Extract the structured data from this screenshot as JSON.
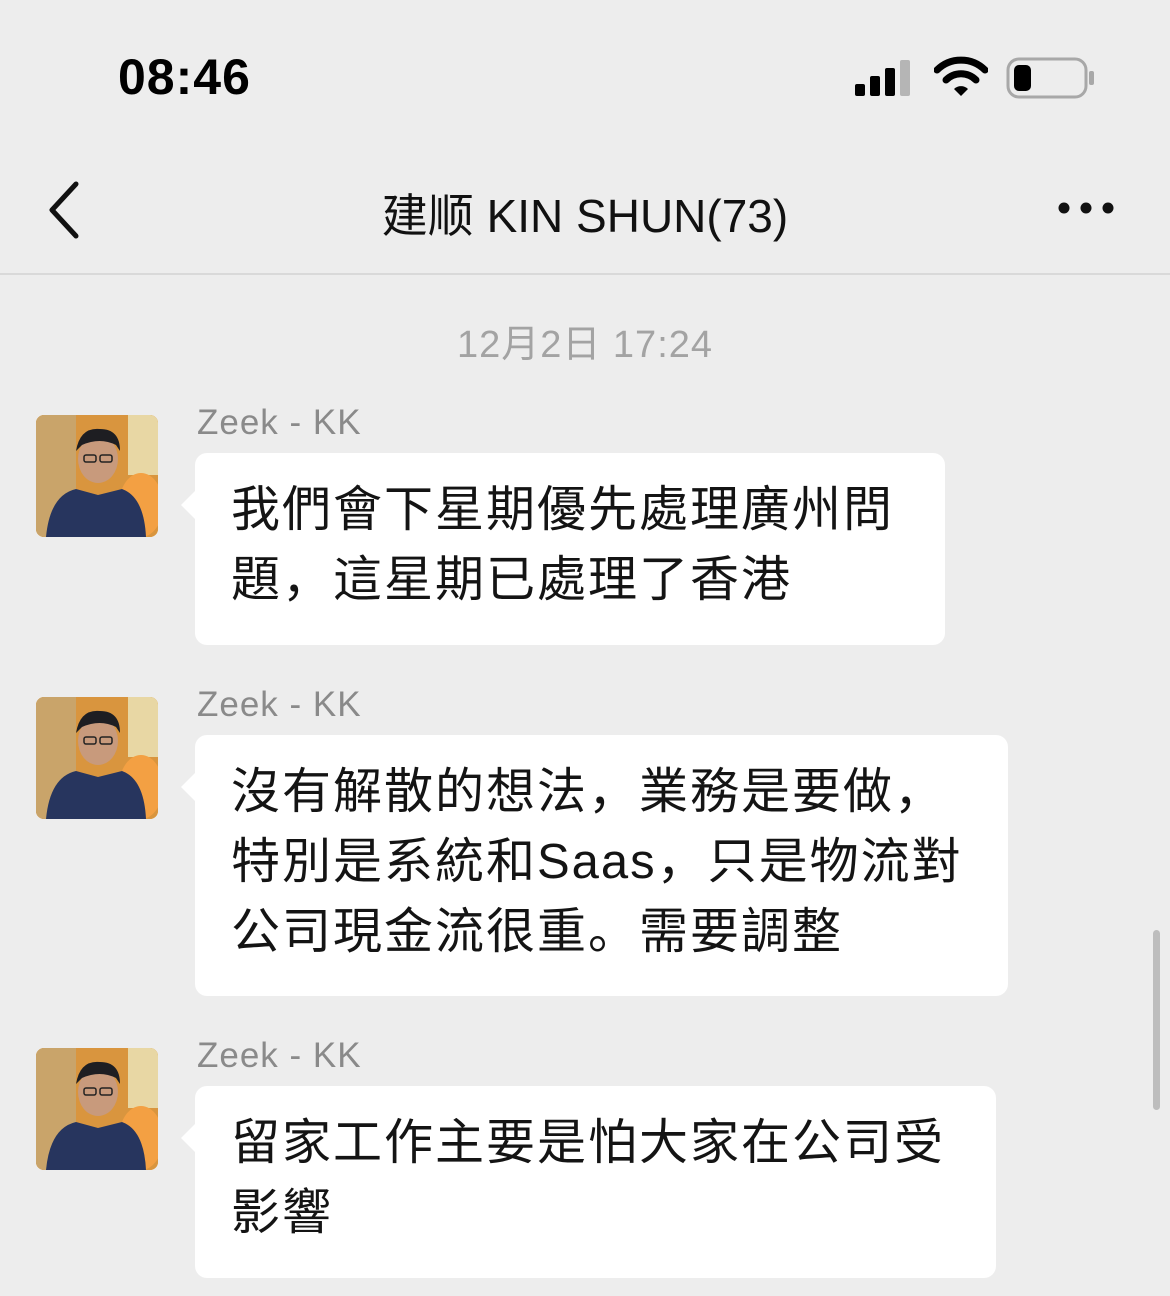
{
  "status_bar": {
    "time": "08:46",
    "signal_icon": "cellular-signal-icon",
    "wifi_icon": "wifi-icon",
    "battery_icon": "battery-low-icon",
    "battery_level": 0.2
  },
  "header": {
    "back_icon": "chevron-left-icon",
    "title": "建顺 KIN SHUN(73)",
    "more_icon": "ellipsis-icon"
  },
  "chat": {
    "timestamp": "12月2日 17:24",
    "messages": [
      {
        "sender": "Zeek - KK",
        "lines": [
          "我們會下星期優先處理廣州問",
          "題，這星期已處理了香港"
        ]
      },
      {
        "sender": "Zeek - KK",
        "lines": [
          "沒有解散的想法，業務是要做，",
          "特別是系統和Saas，只是物流對",
          "公司現金流很重。需要調整"
        ]
      },
      {
        "sender": "Zeek - KK",
        "lines": [
          "留家工作主要是怕大家在公司受",
          "影響"
        ]
      }
    ]
  },
  "colors": {
    "background": "#ededed",
    "bubble": "#ffffff",
    "name": "#8a8a8a",
    "timestamp": "#a3a3a3"
  }
}
